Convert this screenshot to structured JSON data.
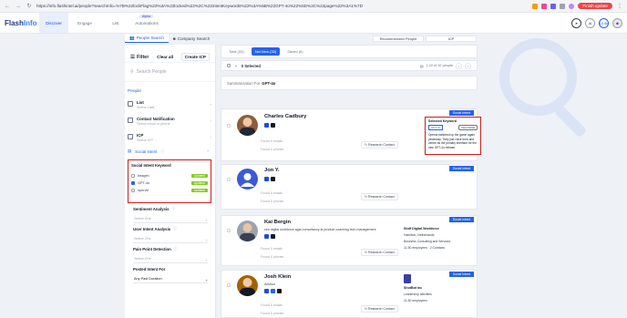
{
  "browser": {
    "url": "https://info.flashintel.ai/people?searchInfo=%7B%22lockFlag%22%3A%22locked%22%2C%22intentKeywords%22%3A%5B%22GPT-4o%22%5D%2C%22page%22%3A1%7D",
    "finish_update": "Finish update"
  },
  "app": {
    "logo_left": "Flash",
    "logo_right": "Info",
    "nav": [
      {
        "label": "Discover"
      },
      {
        "label": "Engage"
      },
      {
        "label": "List"
      },
      {
        "label": "Automations",
        "badge": "Alpha"
      }
    ],
    "right_icons": [
      "rocket-icon",
      "ai-icon",
      "user-avatar-icon"
    ],
    "credits_label": "10.8k"
  },
  "tabs": {
    "people_search": "People Search",
    "company_search": "Company Search",
    "recommended_people": "Recommended People",
    "icp": "ICP"
  },
  "sidebar": {
    "filter_title": "Filter",
    "clear_all": "Clear all",
    "create_icp": "Create ICP",
    "search_placeholder": "Search People",
    "section_people": "People",
    "list": {
      "title": "List",
      "sub": "Select Lists"
    },
    "contact_notification": {
      "title": "Contact Notification",
      "sub": "Select email or phone"
    },
    "icp": {
      "title": "ICP",
      "sub": "Select ICP"
    },
    "social_intent": "Social Intent",
    "keyword_box": {
      "title": "Social Intent Keyword",
      "items": [
        {
          "label": "Imagen",
          "checked": false,
          "tag": "Updated"
        },
        {
          "label": "GPT-4o",
          "checked": true,
          "tag": "Updated"
        },
        {
          "label": "openAI",
          "checked": false,
          "tag": "Updated"
        }
      ]
    },
    "sentiment": {
      "title": "Sentiment Analysis",
      "placeholder": "Select One"
    },
    "user_intent": {
      "title": "User Intent Analysis",
      "placeholder": "Select One"
    },
    "pain_point": {
      "title": "Pain Point Detection",
      "placeholder": "Select One"
    },
    "posted_intent": {
      "title": "Posted Intent For",
      "value": "Any Past Duration"
    }
  },
  "main": {
    "toolbar_tabs": [
      {
        "label": "Total (33)",
        "active": false
      },
      {
        "label": "Net New (32)",
        "active": true
      },
      {
        "label": "Saved (0)",
        "active": false
      }
    ],
    "selected_label": "0 Selected",
    "pager": "1-10 of 32 people",
    "summary_prefix": "Summarization For",
    "summary_keyword": "GPT-4o",
    "badge": "Social Intent",
    "found_email": "Found 0 emails",
    "found_phone": "Found 0 phones",
    "research_label": "Research Contact",
    "people": [
      {
        "name": "Charles Cadbury",
        "title": "",
        "avatar_color": "#8b5e3c"
      },
      {
        "name": "Jon Y.",
        "title": "",
        "avatar_color": "#3b5bd6"
      },
      {
        "name": "Kai Bergin",
        "title": "ceo digital workforce agia consultancy ai product coaching tech management",
        "avatar_color": "#6b7280",
        "company": {
          "name": "Stuff Digital Workforce",
          "lines": [
            "Hamilton, Netherlands",
            "Business Consulting and Services",
            "11-50 employees · 2 Contacts"
          ]
        }
      },
      {
        "name": "Josh Klein",
        "title": "Advisor",
        "avatar_color": "#a16207",
        "company": {
          "name": "ShotBot Inc",
          "lines": [
            "Leadership activities",
            "11-50 employees"
          ]
        }
      }
    ],
    "keyword_panel": {
      "header": "Selected Keyword",
      "chip": "GPT-4o",
      "view": "View Detail",
      "description": "Openai switched up the game again yesterday. They just voice front and centre as the primary interface for the new GPT-4o release."
    }
  }
}
